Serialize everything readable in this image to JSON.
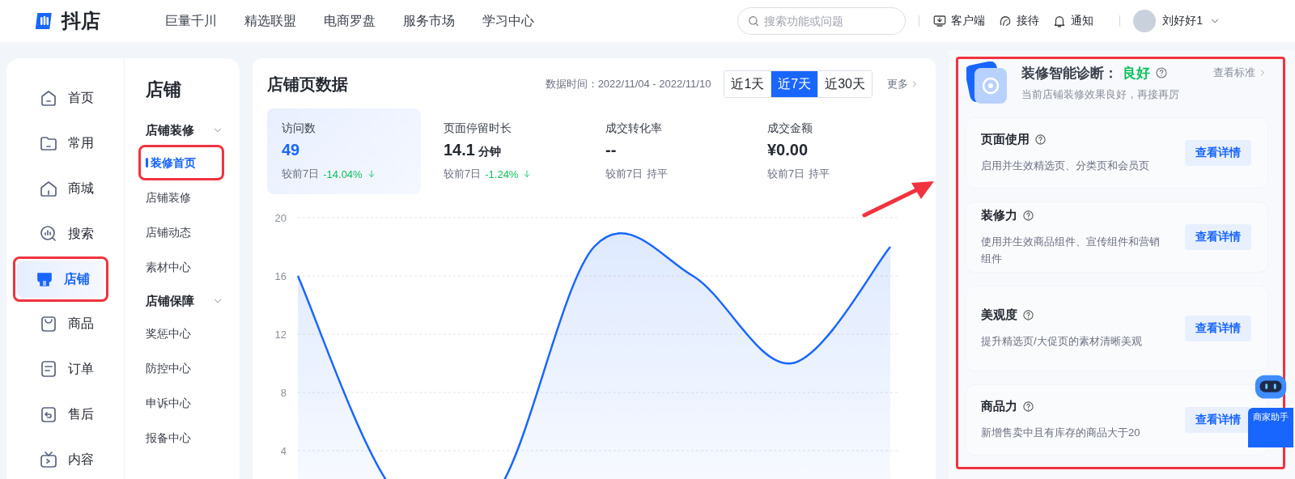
{
  "logo": {
    "text": "抖店"
  },
  "nav": [
    "巨量千川",
    "精选联盟",
    "电商罗盘",
    "服务市场",
    "学习中心"
  ],
  "search": {
    "placeholder": "搜索功能或问题"
  },
  "header_actions": [
    "客户端",
    "接待",
    "通知"
  ],
  "user": {
    "name": "刘好好1"
  },
  "sidebar": {
    "items": [
      {
        "label": "首页",
        "selected": false,
        "highlighted": false
      },
      {
        "label": "常用",
        "selected": false,
        "highlighted": false
      },
      {
        "label": "商城",
        "selected": false,
        "highlighted": false
      },
      {
        "label": "搜索",
        "selected": false,
        "highlighted": false
      },
      {
        "label": "店铺",
        "selected": true,
        "highlighted": true
      },
      {
        "label": "商品",
        "selected": false,
        "highlighted": false
      },
      {
        "label": "订单",
        "selected": false,
        "highlighted": false
      },
      {
        "label": "售后",
        "selected": false,
        "highlighted": false
      },
      {
        "label": "内容",
        "selected": false,
        "highlighted": false
      }
    ]
  },
  "submenu": {
    "title": "店铺",
    "groups": [
      {
        "label": "店铺装修",
        "expanded": true,
        "items": [
          {
            "label": "装修首页",
            "selected": true,
            "highlighted": true
          },
          {
            "label": "店铺装修",
            "selected": false,
            "highlighted": false
          },
          {
            "label": "店铺动态",
            "selected": false,
            "highlighted": false
          },
          {
            "label": "素材中心",
            "selected": false,
            "highlighted": false
          }
        ]
      },
      {
        "label": "店铺保障",
        "expanded": true,
        "items": [
          {
            "label": "奖惩中心",
            "selected": false,
            "highlighted": false
          },
          {
            "label": "防控中心",
            "selected": false,
            "highlighted": false
          },
          {
            "label": "申诉中心",
            "selected": false,
            "highlighted": false
          },
          {
            "label": "报备中心",
            "selected": false,
            "highlighted": false
          }
        ]
      }
    ]
  },
  "stats": {
    "title": "店铺页数据",
    "date_range": "数据时间：2022/11/04 - 2022/11/10",
    "ranges": [
      {
        "label": "近1天",
        "selected": false
      },
      {
        "label": "近7天",
        "selected": true
      },
      {
        "label": "近30天",
        "selected": false
      }
    ],
    "more": "更多",
    "metrics": [
      {
        "label": "访问数",
        "value": "49",
        "compare_label": "较前7日",
        "change": "-14.04%",
        "decreased": true,
        "selected": true
      },
      {
        "label": "页面停留时长",
        "value": "14.1",
        "unit": "分钟",
        "compare_label": "较前7日",
        "change": "-1.24%",
        "decreased": true,
        "selected": false
      },
      {
        "label": "成交转化率",
        "value": "--",
        "compare_label": "较前7日",
        "change": "持平",
        "decreased": false,
        "selected": false
      },
      {
        "label": "成交金额",
        "value": "¥0.00",
        "compare_label": "较前7日",
        "change": "持平",
        "decreased": false,
        "selected": false
      }
    ],
    "chart": {
      "y_axis_labels": [
        "20",
        "16",
        "12",
        "8",
        "4"
      ]
    }
  },
  "diagnosis": {
    "title": "装修智能诊断：",
    "rating": "良好",
    "standard_link": "查看标准",
    "subtitle": "当前店铺装修效果良好，再接再厉",
    "highlighted": true,
    "items": [
      {
        "title": "页面使用",
        "description": "启用并生效精选页、分类页和会员页",
        "button": "查看详情"
      },
      {
        "title": "装修力",
        "description": "使用并生效商品组件、宣传组件和营销组件",
        "button": "查看详情"
      },
      {
        "title": "美观度",
        "description": "提升精选页/大促页的素材清晰美观",
        "button": "查看详情"
      },
      {
        "title": "商品力",
        "description": "新增售卖中且有库存的商品大于20",
        "button": "查看详情"
      }
    ]
  },
  "assistant": {
    "label": "商家助手"
  }
}
